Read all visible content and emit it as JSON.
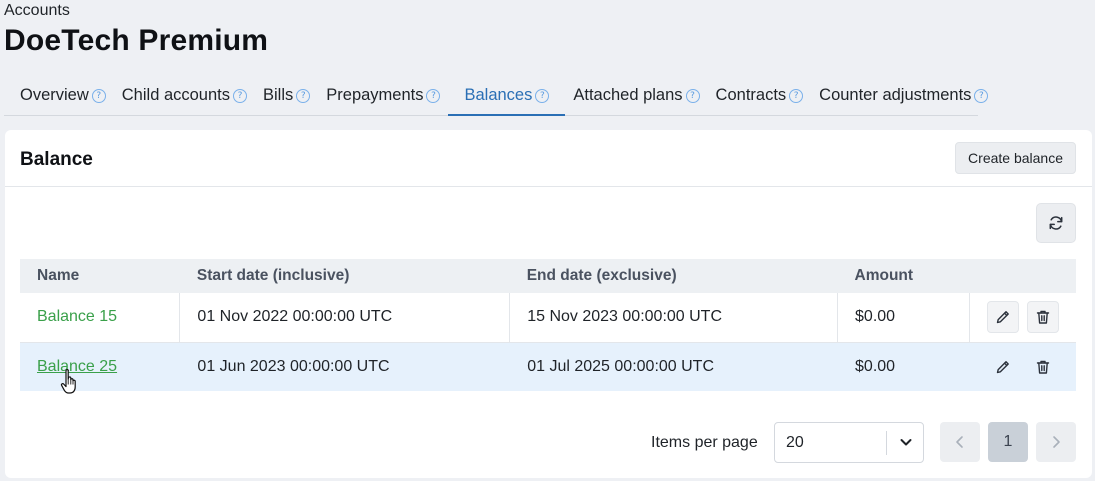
{
  "header": {
    "breadcrumb": "Accounts",
    "title": "DoeTech Premium"
  },
  "tabs": [
    {
      "label": "Overview"
    },
    {
      "label": "Child accounts"
    },
    {
      "label": "Bills"
    },
    {
      "label": "Prepayments"
    },
    {
      "label": "Balances",
      "active": true
    },
    {
      "label": "Attached plans"
    },
    {
      "label": "Contracts"
    },
    {
      "label": "Counter adjustments"
    }
  ],
  "card": {
    "title": "Balance",
    "create_button": "Create balance"
  },
  "table": {
    "columns": [
      "Name",
      "Start date (inclusive)",
      "End date (exclusive)",
      "Amount"
    ],
    "rows": [
      {
        "name": "Balance 15",
        "start": "01 Nov 2022 00:00:00 UTC",
        "end": "15 Nov 2023 00:00:00 UTC",
        "amount": "$0.00"
      },
      {
        "name": "Balance 25",
        "start": "01 Jun 2023 00:00:00 UTC",
        "end": "01 Jul 2025 00:00:00 UTC",
        "amount": "$0.00"
      }
    ]
  },
  "pagination": {
    "items_per_page_label": "Items per page",
    "items_per_page_value": "20",
    "current_page": "1"
  },
  "icons": {
    "help": "question-circle-icon",
    "refresh": "refresh-icon",
    "edit": "pencil-icon",
    "delete": "trash-icon",
    "select": "chevron-down-icon",
    "prev": "chevron-left-icon",
    "next": "chevron-right-icon"
  },
  "colors": {
    "accent": "#2a6fb5",
    "link": "#3aa04a",
    "row_highlight": "#e6f1fc"
  }
}
